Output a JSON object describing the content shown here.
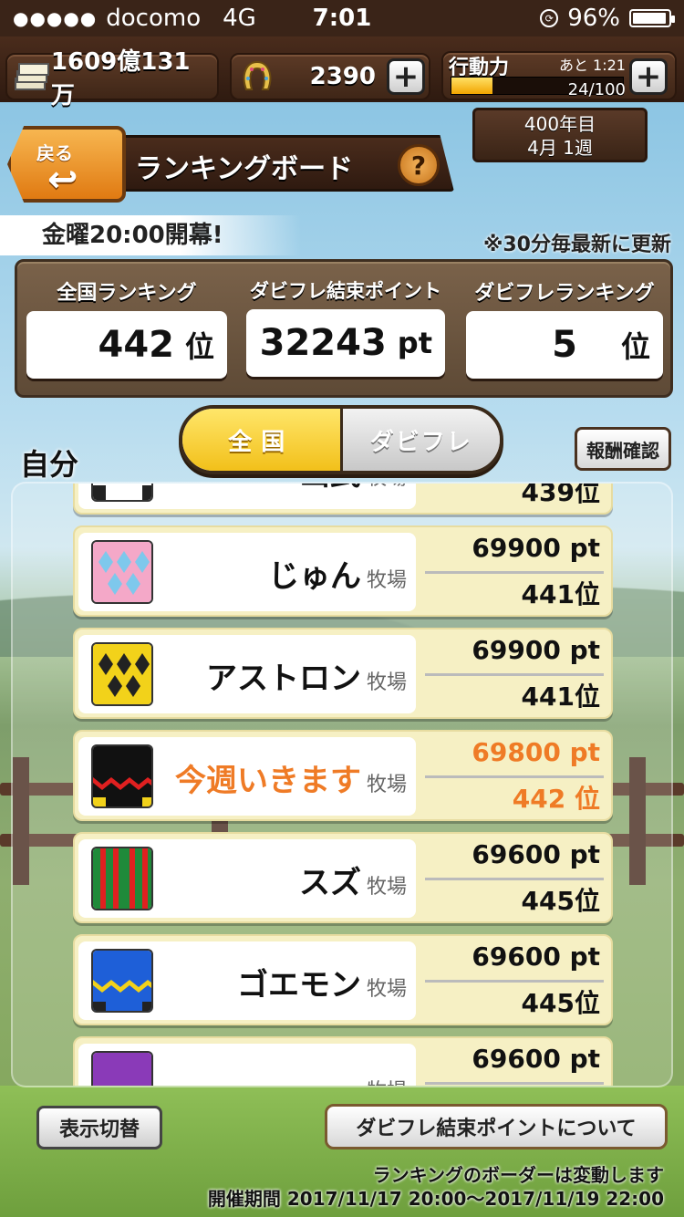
{
  "status_bar": {
    "signal": "●●●●●",
    "carrier": "docomo",
    "network": "4G",
    "time": "7:01",
    "battery": "96%",
    "battery_level": 0.96
  },
  "resources": {
    "money": "1609億131万",
    "horseshoe": "2390",
    "action_label": "行動力",
    "action_remaining": "あと 1:21",
    "action_count": "24/100",
    "action_fraction": 0.24,
    "plus": "+"
  },
  "date": {
    "year": "400年目",
    "week": "4月 1週"
  },
  "header": {
    "back_label": "戻る",
    "back_arrow": "↩",
    "title": "ランキングボード",
    "help": "?"
  },
  "banner": {
    "opening": "金曜20:00開幕!",
    "update_note": "※30分毎最新に更新"
  },
  "summary": {
    "national": {
      "label": "全国ランキング",
      "value": "442",
      "unit": "位"
    },
    "points": {
      "label": "ダビフレ結束ポイント",
      "value": "32243",
      "unit": "pt"
    },
    "friends": {
      "label": "ダビフレランキング",
      "value": "5",
      "unit": "位"
    }
  },
  "tabs": {
    "self_label": "自分",
    "national": "全国",
    "friends": "ダビフレ",
    "reward": "報酬確認"
  },
  "farm_suffix": "牧場",
  "rows": [
    {
      "name": "山武",
      "pt": "",
      "rank": "439位",
      "silk": "silk-blue-zigzag"
    },
    {
      "name": "じゅん",
      "pt": "69900 pt",
      "rank": "441位",
      "silk": "silk-pink-diamond"
    },
    {
      "name": "アストロン",
      "pt": "69900 pt",
      "rank": "441位",
      "silk": "silk-yellow-diamond"
    },
    {
      "name": "今週いきます",
      "pt": "69800 pt",
      "rank": "442 位",
      "silk": "silk-black-red"
    },
    {
      "name": "スズ",
      "pt": "69600 pt",
      "rank": "445位",
      "silk": "silk-green-stripe"
    },
    {
      "name": "ゴエモン",
      "pt": "69600 pt",
      "rank": "445位",
      "silk": "silk-blue-yellow"
    },
    {
      "name": "",
      "pt": "69600 pt",
      "rank": "",
      "silk": "silk-purple"
    }
  ],
  "footer": {
    "switch_label": "表示切替",
    "about_label": "ダビフレ結束ポイントについて",
    "note": "ランキングのボーダーは変動します",
    "period": "開催期間 2017/11/17 20:00～2017/11/19 22:00"
  },
  "colors": {
    "highlight": "#ef7b26",
    "tab_active": "#f2c01a",
    "wood": "#5e4a36"
  }
}
